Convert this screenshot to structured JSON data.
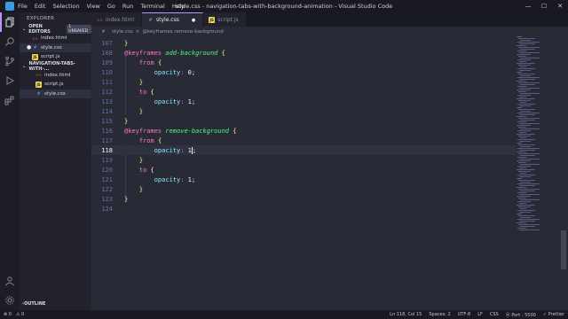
{
  "menu": [
    "File",
    "Edit",
    "Selection",
    "View",
    "Go",
    "Run",
    "Terminal",
    "Help"
  ],
  "window_title": "style.css - navigation-tabs-with-background-animation - Visual Studio Code",
  "window_controls": {
    "minimize": "—",
    "maximize": "☐",
    "close": "✕"
  },
  "sidebar": {
    "title": "EXPLORER",
    "open_editors": {
      "label": "OPEN EDITORS",
      "badge": "1 UNSAVED",
      "files": [
        {
          "name": "index.html",
          "type": "html",
          "dirty": false
        },
        {
          "name": "style.css",
          "type": "css",
          "dirty": true
        },
        {
          "name": "script.js",
          "type": "js",
          "dirty": false
        }
      ]
    },
    "project": {
      "label": "NAVIGATION-TABS-WITH-...",
      "files": [
        {
          "name": "index.html",
          "type": "html"
        },
        {
          "name": "script.js",
          "type": "js"
        },
        {
          "name": "style.css",
          "type": "css"
        }
      ]
    },
    "outline": "OUTLINE"
  },
  "tabs": [
    {
      "name": "index.html",
      "type": "html",
      "active": false
    },
    {
      "name": "style.css",
      "type": "css",
      "active": true,
      "dirty": true
    },
    {
      "name": "script.js",
      "type": "js",
      "active": false
    }
  ],
  "tab_dirty_glyph": "●",
  "breadcrumb": {
    "file": "style.css",
    "separator": ">",
    "symbol": "@keyframes remove-background"
  },
  "code": [
    {
      "n": "107",
      "text": "}"
    },
    {
      "n": "108",
      "text": "@keyframes add-background {"
    },
    {
      "n": "109",
      "text": "    from {"
    },
    {
      "n": "110",
      "text": "        opacity: 0;"
    },
    {
      "n": "111",
      "text": "    }"
    },
    {
      "n": "112",
      "text": "    to {"
    },
    {
      "n": "113",
      "text": "        opacity: 1;"
    },
    {
      "n": "114",
      "text": "    }"
    },
    {
      "n": "115",
      "text": "}"
    },
    {
      "n": "116",
      "text": "@keyframes remove-background {"
    },
    {
      "n": "117",
      "text": "    from {"
    },
    {
      "n": "118",
      "text": "        opacity: 1;"
    },
    {
      "n": "119",
      "text": "    }"
    },
    {
      "n": "120",
      "text": "    to {"
    },
    {
      "n": "121",
      "text": "        opacity: 1;"
    },
    {
      "n": "122",
      "text": "    }"
    },
    {
      "n": "123",
      "text": "}"
    },
    {
      "n": "124",
      "text": ""
    }
  ],
  "current_line": "118",
  "status": {
    "errors": "⊗ 0",
    "warnings": "⚠ 0",
    "position": "Ln 118, Col 15",
    "indent": "Spaces: 2",
    "encoding": "UTF-8",
    "eol": "LF",
    "language": "CSS",
    "live_server": "⦿ Port : 5500",
    "prettier": "✓ Prettier"
  },
  "colors": {
    "accent": "#bd93f9",
    "keyword": "#ff79c6",
    "function": "#50fa7b",
    "property": "#8be9fd",
    "number": "#bd93f9",
    "background": "#282a36"
  }
}
